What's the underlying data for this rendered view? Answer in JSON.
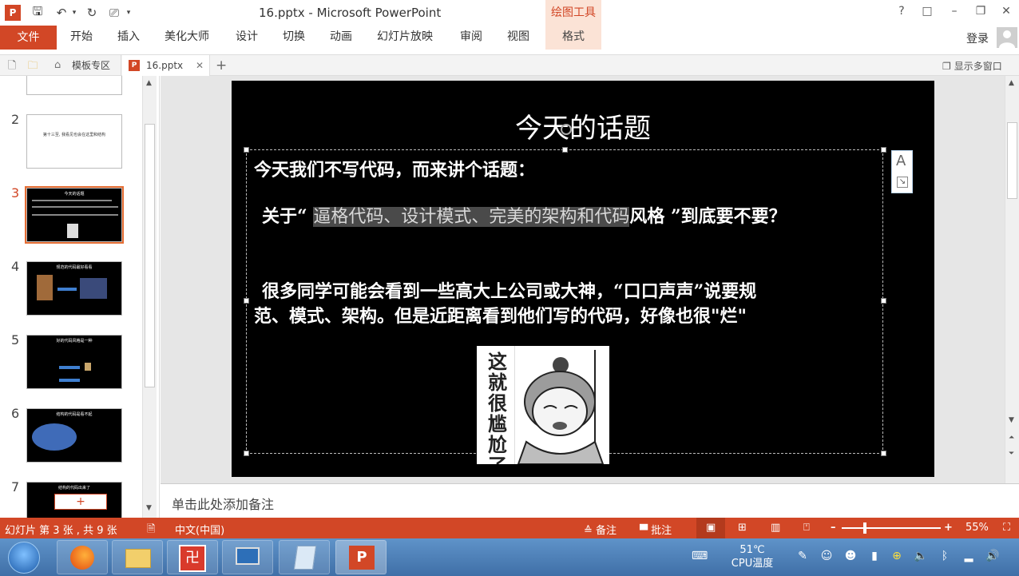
{
  "window": {
    "title": "16.pptx - Microsoft PowerPoint",
    "context_tool": "绘图工具",
    "help": "?",
    "controls": [
      "□",
      "–",
      "❐",
      "✕"
    ]
  },
  "ribbon": {
    "file": "文件",
    "tabs": [
      "开始",
      "插入",
      "美化大师",
      "设计",
      "切换",
      "动画",
      "幻灯片放映",
      "审阅",
      "视图"
    ],
    "format_tab": "格式",
    "login": "登录"
  },
  "tabbar": {
    "tabs": [
      {
        "label": "模板专区"
      },
      {
        "label": "16.pptx"
      }
    ],
    "new_tab": "+",
    "close": "✕",
    "multi_window": "显示多窗口"
  },
  "thumbnails": [
    {
      "num": "",
      "text": ""
    },
    {
      "num": "2",
      "text": "第十三至, 我看见也会在这里和结构"
    },
    {
      "num": "3",
      "text": "今天的话题"
    },
    {
      "num": "4",
      "text": "规范的代码最好看看"
    },
    {
      "num": "5",
      "text": "好的代码风格是一种"
    },
    {
      "num": "6",
      "text": "结构的代码是看不起"
    },
    {
      "num": "7",
      "text": "结构的代码出来了"
    }
  ],
  "slide": {
    "title": "今天的话题",
    "line1": "今天我们不写代码，而来讲个话题：",
    "line2_pre": "关于“ ",
    "line2_hl": "逼格代码、设计模式、完美的架构和代码",
    "line2_post": "风格 ”到底要不要？",
    "line3": "很多同学可能会看到一些高大上公司或大神，“口口声声”说要规",
    "line4": "范、模式、架构。但是近距离看到他们写的代码，好像也很\"烂\"",
    "sticker_chars": [
      "这",
      "就",
      "很",
      "尴",
      "尬",
      "了"
    ]
  },
  "notes": {
    "placeholder": "单击此处添加备注"
  },
  "status": {
    "slide_info": "幻灯片 第 3 张 , 共 9 张",
    "language": "中文(中国)",
    "notes_btn": "备注",
    "comments_btn": "批注",
    "zoom": "55%",
    "zoom_level": 0.55
  },
  "taskbar": {
    "temp": "51℃",
    "temp_label": "CPU温度"
  },
  "colors": {
    "accent": "#d24726",
    "context": "#fbe3d6",
    "selection": "#e46c32"
  }
}
